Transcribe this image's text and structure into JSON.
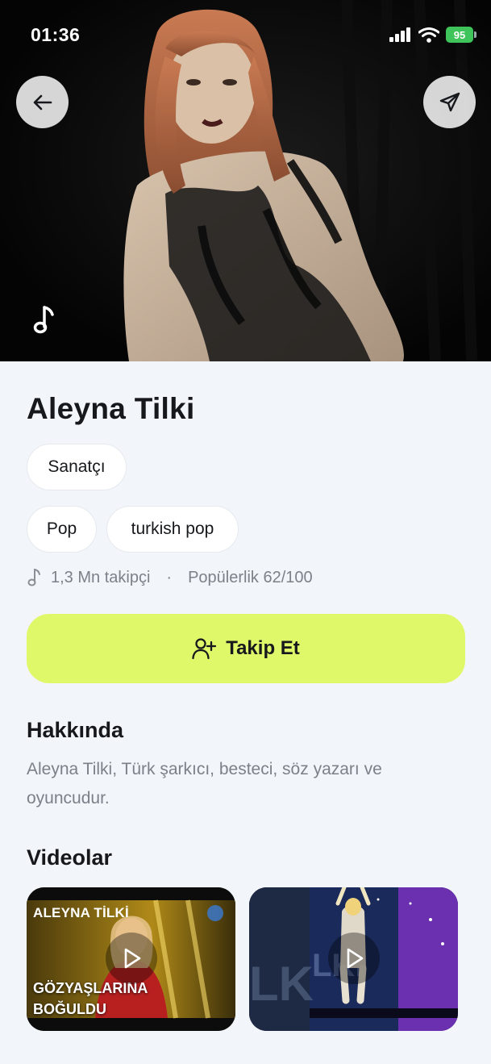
{
  "status_bar": {
    "time": "01:36",
    "battery": "95"
  },
  "hero": {
    "back_icon": "arrow-left-icon",
    "share_icon": "send-icon",
    "music_icon": "music-note-icon"
  },
  "artist": {
    "name": "Aleyna Tilki",
    "role": "Sanatçı",
    "genres": [
      "Pop",
      "turkish pop"
    ],
    "followers": "1,3 Mn takipçi",
    "separator": "·",
    "popularity": "Popülerlik 62/100"
  },
  "follow_button": {
    "label": "Takip Et",
    "icon": "user-plus-icon",
    "color": "#dff86a"
  },
  "about": {
    "title": "Hakkında",
    "text": "Aleyna Tilki, Türk şarkıcı, besteci, söz yazarı ve oyuncudur."
  },
  "videos": {
    "title": "Videolar",
    "items": [
      {
        "overlay_top": "ALEYNA TİLKİ",
        "overlay_bottom": "GÖZYAŞLARINA BOĞULDU"
      },
      {
        "overlay_top": "",
        "overlay_bottom": ""
      }
    ]
  },
  "colors": {
    "background": "#f2f5fa",
    "accent": "#dff86a",
    "muted_text": "#7c8088"
  }
}
